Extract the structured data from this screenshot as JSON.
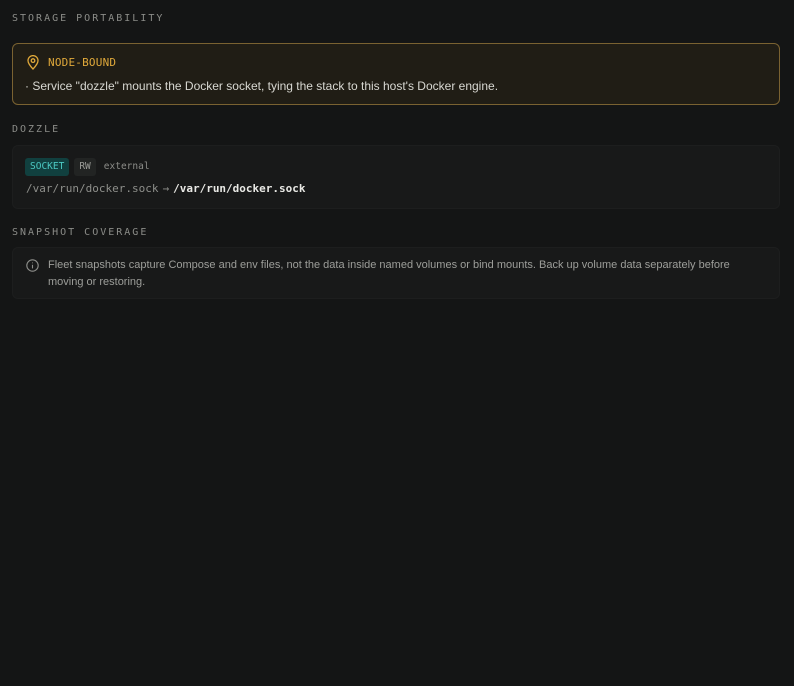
{
  "sections": {
    "storage_portability": "STORAGE PORTABILITY",
    "service": "DOZZLE",
    "snapshot_coverage": "SNAPSHOT COVERAGE"
  },
  "warning": {
    "icon": "map-pin-icon",
    "title": "NODE-BOUND",
    "message": "· Service \"dozzle\" mounts the Docker socket, tying the stack to this host's Docker engine.",
    "color": "#e0a93a"
  },
  "mount": {
    "type_badge": "SOCKET",
    "mode_badge": "RW",
    "scope": "external",
    "source": "/var/run/docker.sock",
    "arrow": "→",
    "target": "/var/run/docker.sock"
  },
  "snapshot_info": {
    "icon": "info-icon",
    "text": "Fleet snapshots capture Compose and env files, not the data inside named volumes or bind mounts. Back up volume data separately before moving or restoring."
  }
}
